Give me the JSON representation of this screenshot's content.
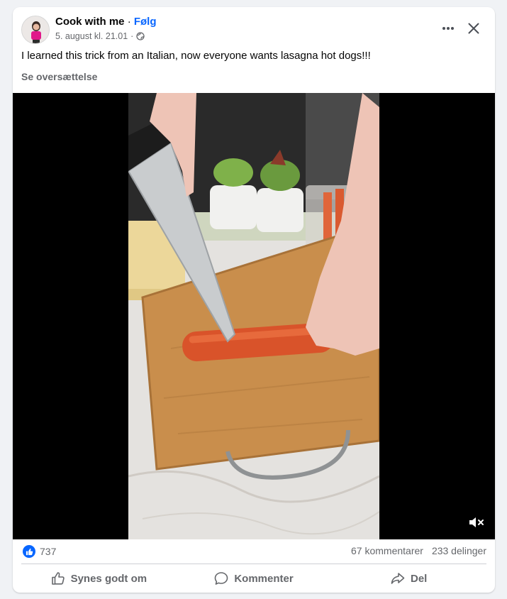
{
  "post": {
    "author": "Cook with me",
    "separator": "·",
    "follow_label": "Følg",
    "timestamp": "5. august kl. 21.01",
    "meta_separator": "·",
    "text": "I learned this trick from an Italian, now everyone wants lasagna hot dogs!!!",
    "translate_label": "Se oversættelse"
  },
  "icons": {
    "privacy": "globe-icon",
    "more": "more-icon",
    "close": "close-icon",
    "mute": "muted-speaker-icon",
    "like_reaction": "thumbs-up-icon",
    "like_action": "thumbs-up-outline-icon",
    "comment_action": "speech-bubble-icon",
    "share_action": "share-arrow-icon"
  },
  "stats": {
    "likes": "737",
    "comments": "67 kommentarer",
    "shares": "233 delinger"
  },
  "actions": {
    "like_label": "Synes godt om",
    "comment_label": "Kommenter",
    "share_label": "Del"
  },
  "colors": {
    "accent": "#0866ff",
    "secondary_text": "#65676b",
    "video_background": "#000000"
  }
}
